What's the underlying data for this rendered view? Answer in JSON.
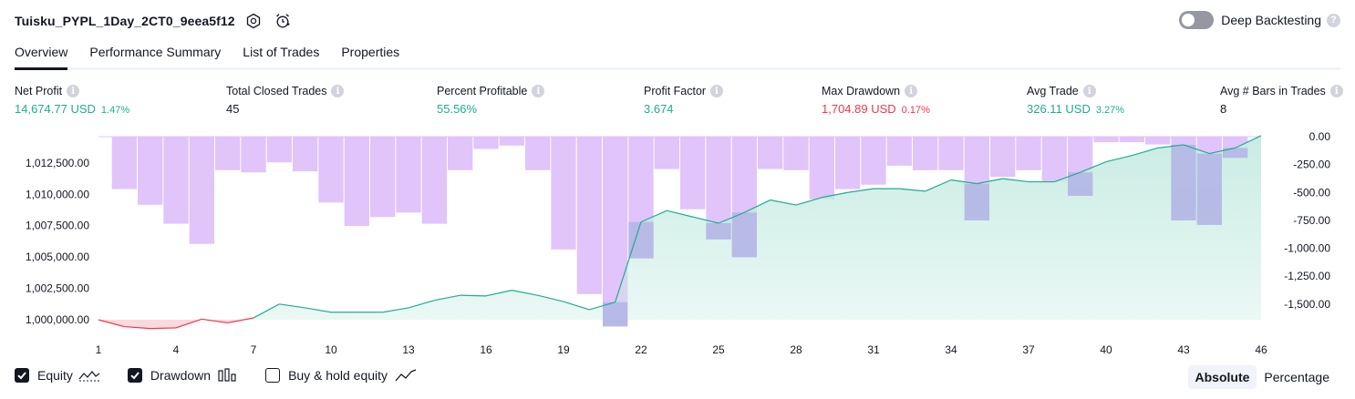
{
  "header": {
    "title": "Tuisku_PYPL_1Day_2CT0_9eea5f12",
    "deep_backtesting_label": "Deep Backtesting",
    "help_mark": "?"
  },
  "tabs": [
    {
      "label": "Overview",
      "active": true
    },
    {
      "label": "Performance Summary",
      "active": false
    },
    {
      "label": "List of Trades",
      "active": false
    },
    {
      "label": "Properties",
      "active": false
    }
  ],
  "metrics": {
    "info_mark": "i",
    "net_profit": {
      "label": "Net Profit",
      "value": "14,674.77 USD",
      "pct": "1.47%"
    },
    "total_closed_trades": {
      "label": "Total Closed Trades",
      "value": "45"
    },
    "percent_profitable": {
      "label": "Percent Profitable",
      "value": "55.56%"
    },
    "profit_factor": {
      "label": "Profit Factor",
      "value": "3.674"
    },
    "max_drawdown": {
      "label": "Max Drawdown",
      "value": "1,704.89 USD",
      "pct": "0.17%"
    },
    "avg_trade": {
      "label": "Avg Trade",
      "value": "326.11 USD",
      "pct": "3.27%"
    },
    "avg_bars": {
      "label": "Avg # Bars in Trades",
      "value": "8"
    }
  },
  "legend": {
    "equity": {
      "label": "Equity",
      "checked": true
    },
    "drawdown": {
      "label": "Drawdown",
      "checked": true
    },
    "buy_hold": {
      "label": "Buy & hold equity",
      "checked": false
    }
  },
  "mode": {
    "absolute": "Absolute",
    "percentage": "Percentage",
    "selected": "Absolute"
  },
  "colors": {
    "green": "#22ab94",
    "red": "#f23645",
    "drawdown_bar": "#e1c4fa",
    "overlap_bar": "#b4b7e6",
    "equity_fill_top": "#c6ebe2"
  },
  "chart_data": {
    "type": "area",
    "x": [
      1,
      2,
      3,
      4,
      5,
      6,
      7,
      8,
      9,
      10,
      11,
      12,
      13,
      14,
      15,
      16,
      17,
      18,
      19,
      20,
      21,
      22,
      23,
      24,
      25,
      26,
      27,
      28,
      29,
      30,
      31,
      32,
      33,
      34,
      35,
      36,
      37,
      38,
      39,
      40,
      41,
      42,
      43,
      44,
      45,
      46
    ],
    "x_tick_labels": [
      "1",
      "4",
      "7",
      "10",
      "13",
      "16",
      "19",
      "22",
      "25",
      "28",
      "31",
      "34",
      "37",
      "40",
      "43",
      "46"
    ],
    "equity": {
      "name": "Equity",
      "values": [
        1000000,
        999450,
        999300,
        999350,
        1000050,
        999750,
        1000150,
        1001250,
        1000950,
        1000600,
        1000600,
        1000600,
        1000950,
        1001550,
        1001950,
        1001900,
        1002350,
        1001950,
        1001450,
        1000800,
        1001400,
        1007800,
        1008700,
        1008200,
        1007700,
        1008550,
        1009550,
        1009150,
        1009750,
        1010150,
        1010450,
        1010450,
        1010250,
        1011150,
        1010850,
        1011250,
        1011000,
        1011000,
        1011750,
        1012600,
        1013100,
        1013700,
        1013950,
        1013250,
        1013700,
        1014674.77
      ],
      "ylim": [
        1000000,
        1014600
      ],
      "y_tick_labels": [
        "1,000,000.00",
        "1,002,500.00",
        "1,005,000.00",
        "1,007,500.00",
        "1,010,000.00",
        "1,012,500.00"
      ]
    },
    "drawdown": {
      "name": "Drawdown",
      "values": [
        0,
        -470,
        -610,
        -780,
        -960,
        -300,
        -320,
        -230,
        -310,
        -590,
        -800,
        -720,
        -680,
        -780,
        -300,
        -110,
        -80,
        -300,
        -1010,
        -1410,
        -1700,
        -1090,
        -290,
        -650,
        -920,
        -1080,
        -290,
        -300,
        -560,
        -470,
        -430,
        -260,
        -300,
        -300,
        -750,
        -360,
        -300,
        -400,
        -530,
        -50,
        -50,
        -70,
        -750,
        -790,
        -190,
        0
      ],
      "ylim": [
        -1704.89,
        0
      ],
      "y_tick_labels": [
        "0.00",
        "-250.00",
        "-500.00",
        "-750.00",
        "-1,000.00",
        "-1,250.00",
        "-1,500.00"
      ]
    }
  }
}
